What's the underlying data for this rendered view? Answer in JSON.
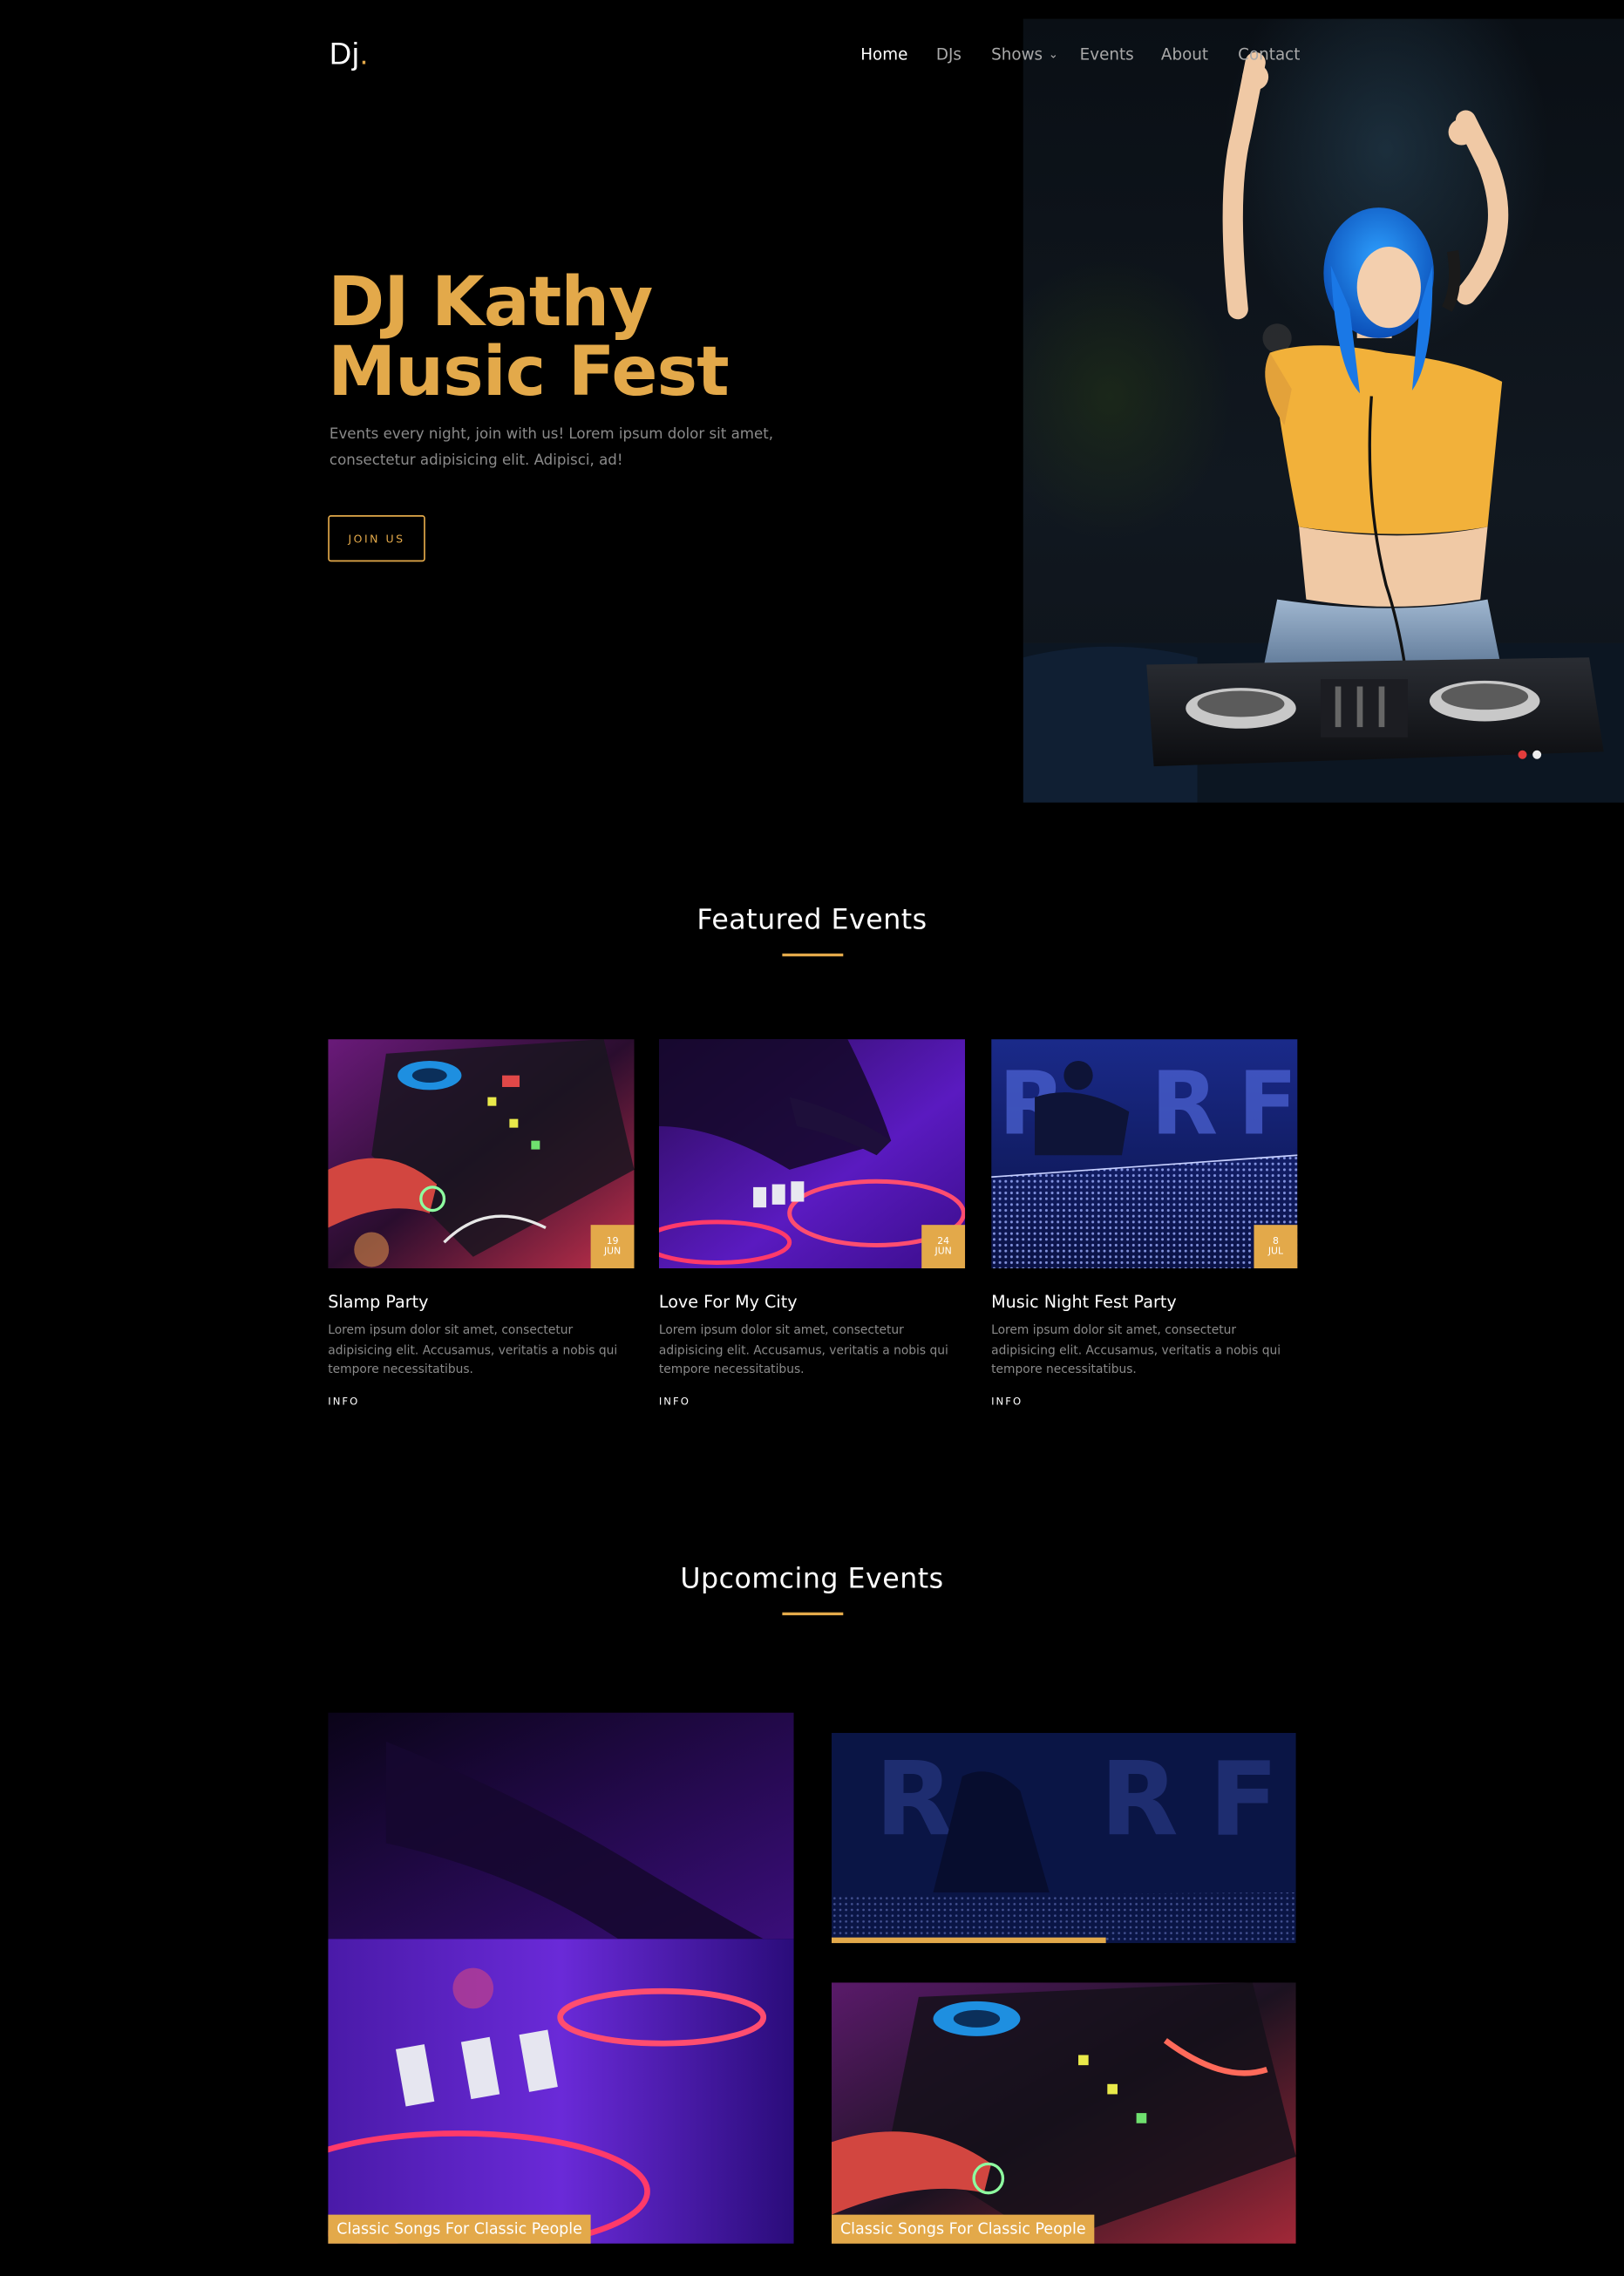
{
  "header": {
    "logo_text": "Dj",
    "logo_dot": ".",
    "nav": [
      {
        "label": "Home",
        "active": true
      },
      {
        "label": "DJs",
        "active": false
      },
      {
        "label": "Shows",
        "active": false,
        "dropdown": true
      },
      {
        "label": "Events",
        "active": false
      },
      {
        "label": "About",
        "active": false
      },
      {
        "label": "Contact",
        "active": false
      }
    ]
  },
  "hero": {
    "title_line1": "DJ Kathy",
    "title_line2": "Music Fest",
    "description": "Events every night, join with us! Lorem ipsum dolor sit amet, consectetur adipisicing elit. Adipisci, ad!",
    "cta_label": "JOIN US"
  },
  "featured": {
    "title": "Featured Events",
    "cards": [
      {
        "title": "Slamp Party",
        "day": "19",
        "month": "JUN",
        "text": "Lorem ipsum dolor sit amet, consectetur adipisicing elit. Accusamus, veritatis a nobis qui tempore necessitatibus.",
        "link": "INFO"
      },
      {
        "title": "Love For My City",
        "day": "24",
        "month": "JUN",
        "text": "Lorem ipsum dolor sit amet, consectetur adipisicing elit. Accusamus, veritatis a nobis qui tempore necessitatibus.",
        "link": "INFO"
      },
      {
        "title": "Music Night Fest Party",
        "day": "8",
        "month": "JUL",
        "text": "Lorem ipsum dolor sit amet, consectetur adipisicing elit. Accusamus, veritatis a nobis qui tempore necessitatibus.",
        "link": "INFO"
      }
    ]
  },
  "upcoming": {
    "title": "Upcomcing Events",
    "captions": [
      "Classic Songs For Classic People",
      "Classic Songs For Classic People"
    ]
  },
  "colors": {
    "accent": "#e3a94a",
    "background": "#000000",
    "muted_text": "#8a8a8a",
    "nav_inactive": "#a9a9a9"
  }
}
